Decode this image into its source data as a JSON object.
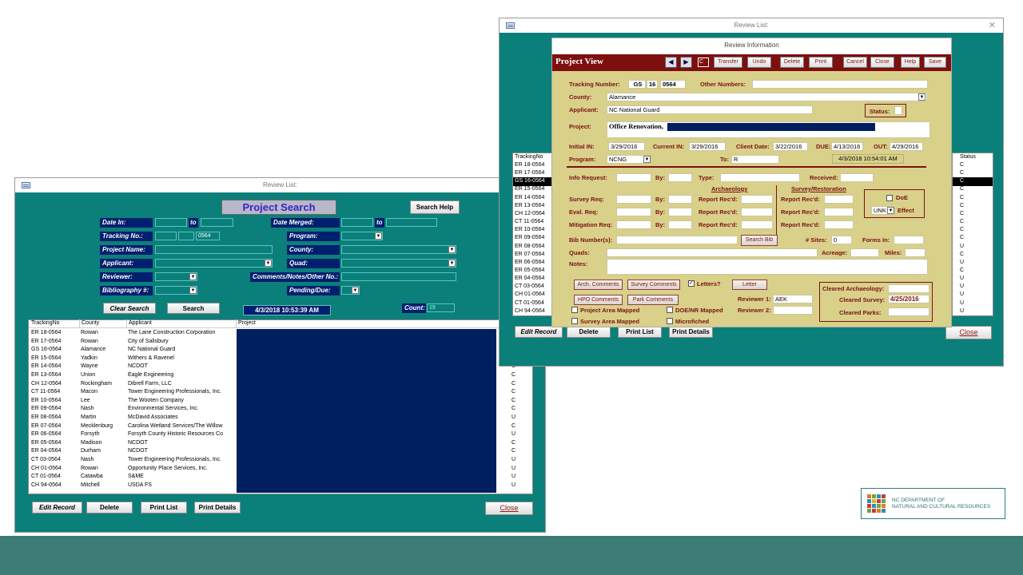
{
  "left_window": {
    "title": "Review List:",
    "form_title": "Project Search",
    "search_help": "Search Help",
    "labels": {
      "date_in": "Date In:",
      "to": "to",
      "date_merged": "Date Merged:",
      "tracking_no": "Tracking No.:",
      "program": "Program:",
      "project_name": "Project Name:",
      "county": "County:",
      "applicant": "Applicant:",
      "quad": "Quad:",
      "reviewer": "Reviewer:",
      "comments": "Comments/Notes/Other No.:",
      "bibliography": "Bibliography #:",
      "pending_due": "Pending/Due:"
    },
    "tracking_value": "0564",
    "clear_search": "Clear Search",
    "search": "Search",
    "timestamp": "4/3/2018 10:53:39 AM",
    "count_label": "Count:",
    "count_value": "19",
    "columns": [
      "TrackingNo",
      "County",
      "Applicant",
      "Project"
    ],
    "rows": [
      {
        "tracking": "ER 18-0564",
        "county": "Rowan",
        "applicant": "The Lane Construction Corporation",
        "status": "C"
      },
      {
        "tracking": "ER 17-0564",
        "county": "Rowan",
        "applicant": "City of Salisbury",
        "status": "C"
      },
      {
        "tracking": "GS 16-0564",
        "county": "Alamance",
        "applicant": "NC National Guard",
        "status": "C"
      },
      {
        "tracking": "ER 15-0564",
        "county": "Yadkin",
        "applicant": "Withers & Ravenel",
        "status": "C"
      },
      {
        "tracking": "ER 14-0564",
        "county": "Wayne",
        "applicant": "NCDOT",
        "status": "C"
      },
      {
        "tracking": "ER 13-0564",
        "county": "Union",
        "applicant": "Eagle Engineering",
        "status": "C"
      },
      {
        "tracking": "CH 12-0564",
        "county": "Rockingham",
        "applicant": "Dibrell Farm, LLC",
        "status": "C"
      },
      {
        "tracking": "CT 11-0564",
        "county": "Macon",
        "applicant": "Tower Engineering Professionals, Inc.",
        "status": "C"
      },
      {
        "tracking": "ER 10-0564",
        "county": "Lee",
        "applicant": "The Wooten Company",
        "status": "C"
      },
      {
        "tracking": "ER 09-0564",
        "county": "Nash",
        "applicant": "Environmental Services, Inc.",
        "status": "C"
      },
      {
        "tracking": "ER 08-0564",
        "county": "Martin",
        "applicant": "McDavid Associates",
        "status": "U"
      },
      {
        "tracking": "ER 07-0564",
        "county": "Mecklenburg",
        "applicant": "Carolina Wetland Services/The Willow",
        "status": "C"
      },
      {
        "tracking": "ER 06-0564",
        "county": "Forsyth",
        "applicant": "Forsyth County Historic Resources Co",
        "status": "U"
      },
      {
        "tracking": "ER 05-0564",
        "county": "Madison",
        "applicant": "NCDOT",
        "status": "C"
      },
      {
        "tracking": "ER 04-0564",
        "county": "Durham",
        "applicant": "NCDOT",
        "status": "C"
      },
      {
        "tracking": "CT 03-0564",
        "county": "Nash",
        "applicant": "Tower Engineering Professionals, Inc.",
        "status": "U"
      },
      {
        "tracking": "CH 01-0564",
        "county": "Rowan",
        "applicant": "Opportunity Place Services, Inc.",
        "status": "U"
      },
      {
        "tracking": "CT 01-0564",
        "county": "Catawba",
        "applicant": "S&ME",
        "status": "U"
      },
      {
        "tracking": "CH 94-0564",
        "county": "Mitchell",
        "applicant": "USDA FS",
        "status": "U"
      }
    ],
    "edit_record": "Edit Record",
    "delete": "Delete",
    "print_list": "Print List",
    "print_details": "Print Details",
    "close": "Close"
  },
  "right_window": {
    "title": "Review List:",
    "popup_title": "Review Information",
    "header_title": "Project View",
    "record_box": "C",
    "toolbar": [
      "Transfer",
      "Undo",
      "Delete",
      "Print",
      "Cancel",
      "Close",
      "Help",
      "Save"
    ],
    "tracking_label": "Tracking Number:",
    "tracking_prefix": "GS",
    "tracking_year": "16",
    "tracking_num": "0564",
    "other_numbers": "Other Numbers:",
    "county_label": "County:",
    "county": "Alamance",
    "applicant_label": "Applicant:",
    "applicant": "NC National Guard",
    "status_label": "Status:",
    "project_label": "Project:",
    "project": "Office Renovation,",
    "initial_in_label": "Initial IN:",
    "initial_in": "3/29/2016",
    "current_in_label": "Current  IN:",
    "current_in": "3/29/2016",
    "client_date_label": "Client Date:",
    "client_date": "3/22/2016",
    "due_label": "DUE:",
    "due": "4/13/2016",
    "out_label": "OUT:",
    "out": "4/29/2016",
    "program_label": "Program:",
    "program": "NCNG",
    "to_label": "To:",
    "to": "R",
    "timestamp": "4/3/2018 10:54:01 AM",
    "info_request": "Info Request:",
    "by": "By:",
    "type": "Type:",
    "received": "Received:",
    "archaeology": "Archaeology",
    "survey_restoration": "Survey/Restoration",
    "survey_req": "Survey Req:",
    "eval_req": "Eval. Req:",
    "mitigation_req": "Mitigation Req:",
    "report_recd": "Report Rec'd:",
    "doe": "DoE",
    "effect_value": "UNK",
    "effect": "Effect",
    "bib_numbers": "Bib Number(s):",
    "search_bib": "Search Bib",
    "sites": "# Sites:",
    "sites_value": "0",
    "forms_in": "Forms In:",
    "quads": "Quads:",
    "acreage": "Acreage:",
    "miles": "Miles:",
    "notes": "Notes:",
    "arch_comments": "Arch. Comments",
    "survey_comments": "Survey Comments",
    "letters": "Letters?",
    "letter": "Letter",
    "hpo_comments": "HPO Comments",
    "park_comments": "Park Comments",
    "reviewer1": "Reviewer 1:",
    "reviewer1_value": "AEK",
    "reviewer2": "Reviewer 2:",
    "project_area_mapped": "Project Area Mapped",
    "survey_area_mapped": "Survey Area Mapped",
    "doe_nr_mapped": "DOE/NR Mapped",
    "microfiched": "Microfiched",
    "cleared_archaeology": "Cleared Archaeology:",
    "cleared_survey": "Cleared Survey:",
    "cleared_survey_value": "4/25/2016",
    "cleared_parks": "Cleared Parks:",
    "list_header_tracking": "TrackingNo",
    "list_header_status": "Status",
    "list_status": [
      "C",
      "C",
      "C",
      "C",
      "C",
      "C",
      "C",
      "C",
      "C",
      "C",
      "U",
      "C",
      "U",
      "C",
      "U",
      "U",
      "U",
      "U",
      "U"
    ],
    "edit_record": "Edit Record",
    "delete": "Delete",
    "print_list": "Print List",
    "print_details": "Print Details",
    "close": "Close"
  },
  "logo": {
    "line1": "NC DEPARTMENT OF",
    "line2": "NATURAL AND CULTURAL RESOURCES"
  },
  "colors": {
    "teal": "#0b7f7a",
    "navy": "#001f6e",
    "khaki": "#d9d08a",
    "maroon": "#7a1212",
    "band": "#3b7c74"
  }
}
